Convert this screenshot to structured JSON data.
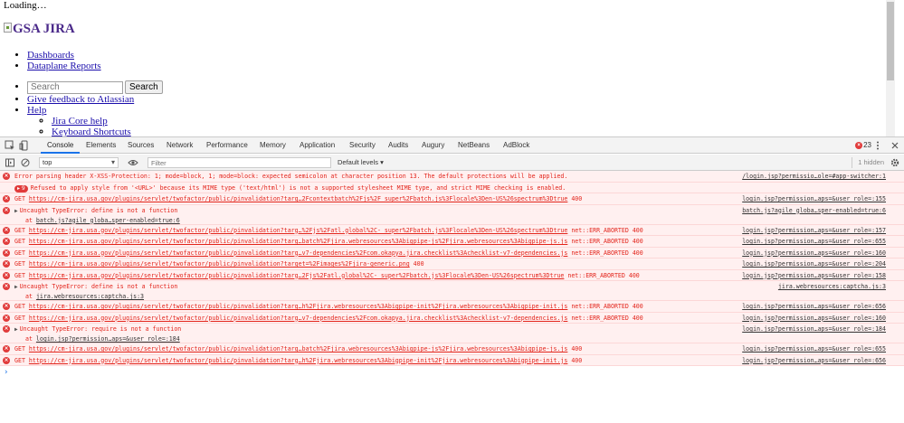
{
  "page": {
    "loading_text": "Loading…",
    "logo_alt": "GSA JIRA",
    "nav": [
      "Dashboards",
      "Dataplane Reports"
    ],
    "search_placeholder": "Search",
    "search_button": "Search",
    "feedback_link": "Give feedback to Atlassian",
    "help_link": "Help",
    "help_sub": [
      "Jira Core help",
      "Keyboard Shortcuts"
    ]
  },
  "devtools": {
    "tabs": [
      "Console",
      "Elements",
      "Sources",
      "Network",
      "Performance",
      "Memory",
      "Application",
      "Security",
      "Audits",
      "Augury",
      "NetBeans",
      "AdBlock"
    ],
    "active_tab": "Console",
    "error_count": "23",
    "context": "top",
    "filter_placeholder": "Filter",
    "levels_label": "Default levels ▾",
    "hidden_label": "1 hidden",
    "accent": "#1a73e8",
    "error_color": "#e3241b"
  },
  "console": {
    "messages": [
      {
        "kind": "error",
        "text": "Error parsing header X-XSS-Protection: 1; mode=block, 1; mode=block: expected semicolon at character position 13. The default protections will be applied.",
        "source": "/login.jsp?permissio…ole=#app-switcher:1"
      },
      {
        "kind": "group",
        "badge": "9",
        "text": "Refused to apply style from '<URL>' because its MIME type ('text/html') is not a supported stylesheet MIME type, and strict MIME checking is enabled.",
        "source": ""
      },
      {
        "kind": "get",
        "url": "https://cm-jira.usa.gov/plugins/servlet/twofactor/public/pinvalidation?targ…2Fcontextbatch%2Fjs%2F_super%2Fbatch.js%3Flocale%3Den-US%26spectrum%3Dtrue",
        "status": "400",
        "source": "login.jsp?permission…aps=&user_role=:155"
      },
      {
        "kind": "uncaught",
        "text": "Uncaught TypeError: define is not a function",
        "at": "batch.js?agile_globa…sper-enabled=true:6",
        "source": "batch.js?agile_globa…sper-enabled=true:6"
      },
      {
        "kind": "get",
        "url": "https://cm-jira.usa.gov/plugins/servlet/twofactor/public/pinvalidation?targ…%2Fjs%2Fatl.global%2C-_super%2Fbatch.js%3Flocale%3Den-US%26spectrum%3Dtrue",
        "status": "net::ERR_ABORTED 400",
        "source": "login.jsp?permission…aps=&user_role=:157"
      },
      {
        "kind": "get",
        "url": "https://cm-jira.usa.gov/plugins/servlet/twofactor/public/pinvalidation?targ…batch%2Fjira.webresources%3Abigpipe-js%2Fjira.webresources%3Abigpipe-js.js",
        "status": "net::ERR_ABORTED 400",
        "source": "login.jsp?permission…aps=&user_role=:655"
      },
      {
        "kind": "get",
        "url": "https://cm-jira.usa.gov/plugins/servlet/twofactor/public/pinvalidation?targ…v7-dependencies%2Fcom.okapya.jira.checklist%3Achecklist-v7-dependencies.js",
        "status": "net::ERR_ABORTED 400",
        "source": "login.jsp?permission…aps=&user_role=:160"
      },
      {
        "kind": "get",
        "url": "https://cm-jira.usa.gov/plugins/servlet/twofactor/public/pinvalidation?target=%2Fimages%2Fjira-generic.png",
        "status": "400",
        "source": "login.jsp?permission…aps=&user_role=:204"
      },
      {
        "kind": "get",
        "url": "https://cm-jira.usa.gov/plugins/servlet/twofactor/public/pinvalidation?targ…2Fjs%2Fatl.global%2C-_super%2Fbatch.js%3Flocale%3Den-US%26spectrum%3Dtrue",
        "status": "net::ERR_ABORTED 400",
        "source": "login.jsp?permission…aps=&user_role=:158"
      },
      {
        "kind": "uncaught",
        "text": "Uncaught TypeError: define is not a function",
        "at": "jira.webresources:captcha.js:3",
        "source": "jira.webresources:captcha.js:3"
      },
      {
        "kind": "get",
        "url": "https://cm-jira.usa.gov/plugins/servlet/twofactor/public/pinvalidation?targ…h%2Fjira.webresources%3Abigpipe-init%2Fjira.webresources%3Abigpipe-init.js",
        "status": "net::ERR_ABORTED 400",
        "source": "login.jsp?permission…aps=&user_role=:656"
      },
      {
        "kind": "get",
        "url": "https://cm-jira.usa.gov/plugins/servlet/twofactor/public/pinvalidation?targ…v7-dependencies%2Fcom.okapya.jira.checklist%3Achecklist-v7-dependencies.js",
        "status": "net::ERR_ABORTED 400",
        "source": "login.jsp?permission…aps=&user_role=:160"
      },
      {
        "kind": "uncaught",
        "text": "Uncaught TypeError: require is not a function",
        "at": "login.jsp?permission…aps=&user_role=:184",
        "source": "login.jsp?permission…aps=&user_role=:184"
      },
      {
        "kind": "get",
        "url": "https://cm-jira.usa.gov/plugins/servlet/twofactor/public/pinvalidation?targ…batch%2Fjira.webresources%3Abigpipe-js%2Fjira.webresources%3Abigpipe-js.js",
        "status": "400",
        "source": "login.jsp?permission…aps=&user_role=:655"
      },
      {
        "kind": "get",
        "url": "https://cm-jira.usa.gov/plugins/servlet/twofactor/public/pinvalidation?targ…h%2Fjira.webresources%3Abigpipe-init%2Fjira.webresources%3Abigpipe-init.js",
        "status": "400",
        "source": "login.jsp?permission…aps=&user_role=:656"
      }
    ],
    "prompt": "›"
  }
}
